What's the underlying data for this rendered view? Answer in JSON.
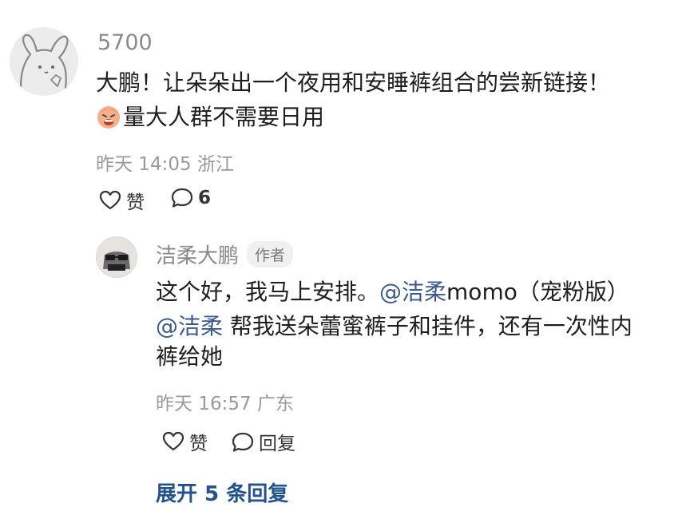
{
  "comment": {
    "username": "5700",
    "line1": "大鹏！让朵朵出一个夜用和安睡裤组合的尝新链接！",
    "line2": "量大人群不需要日用",
    "emoji_icon": "tired-face-emoji-icon",
    "time": "昨天 14:05",
    "location": "浙江",
    "like_label": "赞",
    "reply_count": "6"
  },
  "reply": {
    "username": "洁柔大鹏",
    "author_badge": "作者",
    "line1_text": "这个好，我马上安排。",
    "mention1": "@洁柔",
    "line1_after_mention": "momo（宠粉版）",
    "mention2": "@洁柔",
    "line2_text": " 帮我送朵蕾蜜裤子和挂件，还有一次性内",
    "line3_text": "裤给她",
    "time": "昨天 16:57",
    "location": "广东",
    "like_label": "赞",
    "reply_label": "回复"
  },
  "expand_replies": "展开 5 条回复",
  "colors": {
    "mention": "#3a5a8c",
    "expand": "#23528c",
    "meta": "#9a9a9a"
  }
}
